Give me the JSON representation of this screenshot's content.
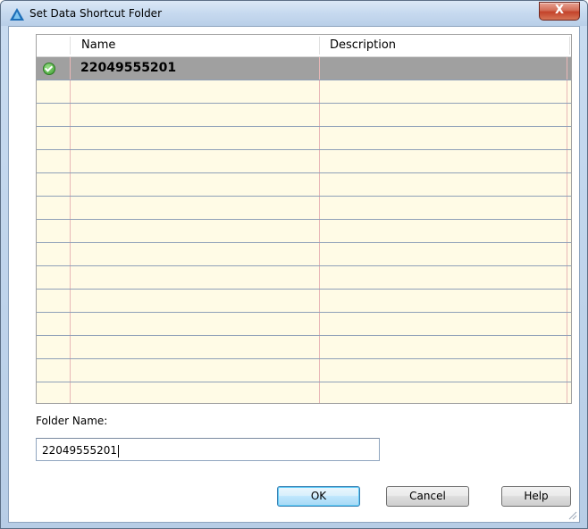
{
  "window": {
    "title": "Set Data Shortcut Folder",
    "close_label": "X"
  },
  "grid": {
    "columns": [
      "Name",
      "Description"
    ],
    "rows": [
      {
        "name": "22049555201",
        "description": "",
        "selected": true,
        "status_icon": "check-circle-icon"
      },
      {
        "name": "",
        "description": ""
      },
      {
        "name": "",
        "description": ""
      },
      {
        "name": "",
        "description": ""
      },
      {
        "name": "",
        "description": ""
      },
      {
        "name": "",
        "description": ""
      },
      {
        "name": "",
        "description": ""
      },
      {
        "name": "",
        "description": ""
      },
      {
        "name": "",
        "description": ""
      },
      {
        "name": "",
        "description": ""
      },
      {
        "name": "",
        "description": ""
      },
      {
        "name": "",
        "description": ""
      },
      {
        "name": "",
        "description": ""
      },
      {
        "name": "",
        "description": ""
      },
      {
        "name": "",
        "description": ""
      },
      {
        "name": "",
        "description": ""
      }
    ]
  },
  "folder": {
    "label": "Folder Name:",
    "value": "22049555201"
  },
  "buttons": {
    "ok": "OK",
    "cancel": "Cancel",
    "help": "Help"
  },
  "colors": {
    "grid_background": "#fffbe6",
    "selected_row": "#a0a0a0",
    "row_line": "#8fa0b8",
    "column_line": "#e8b7b7"
  }
}
